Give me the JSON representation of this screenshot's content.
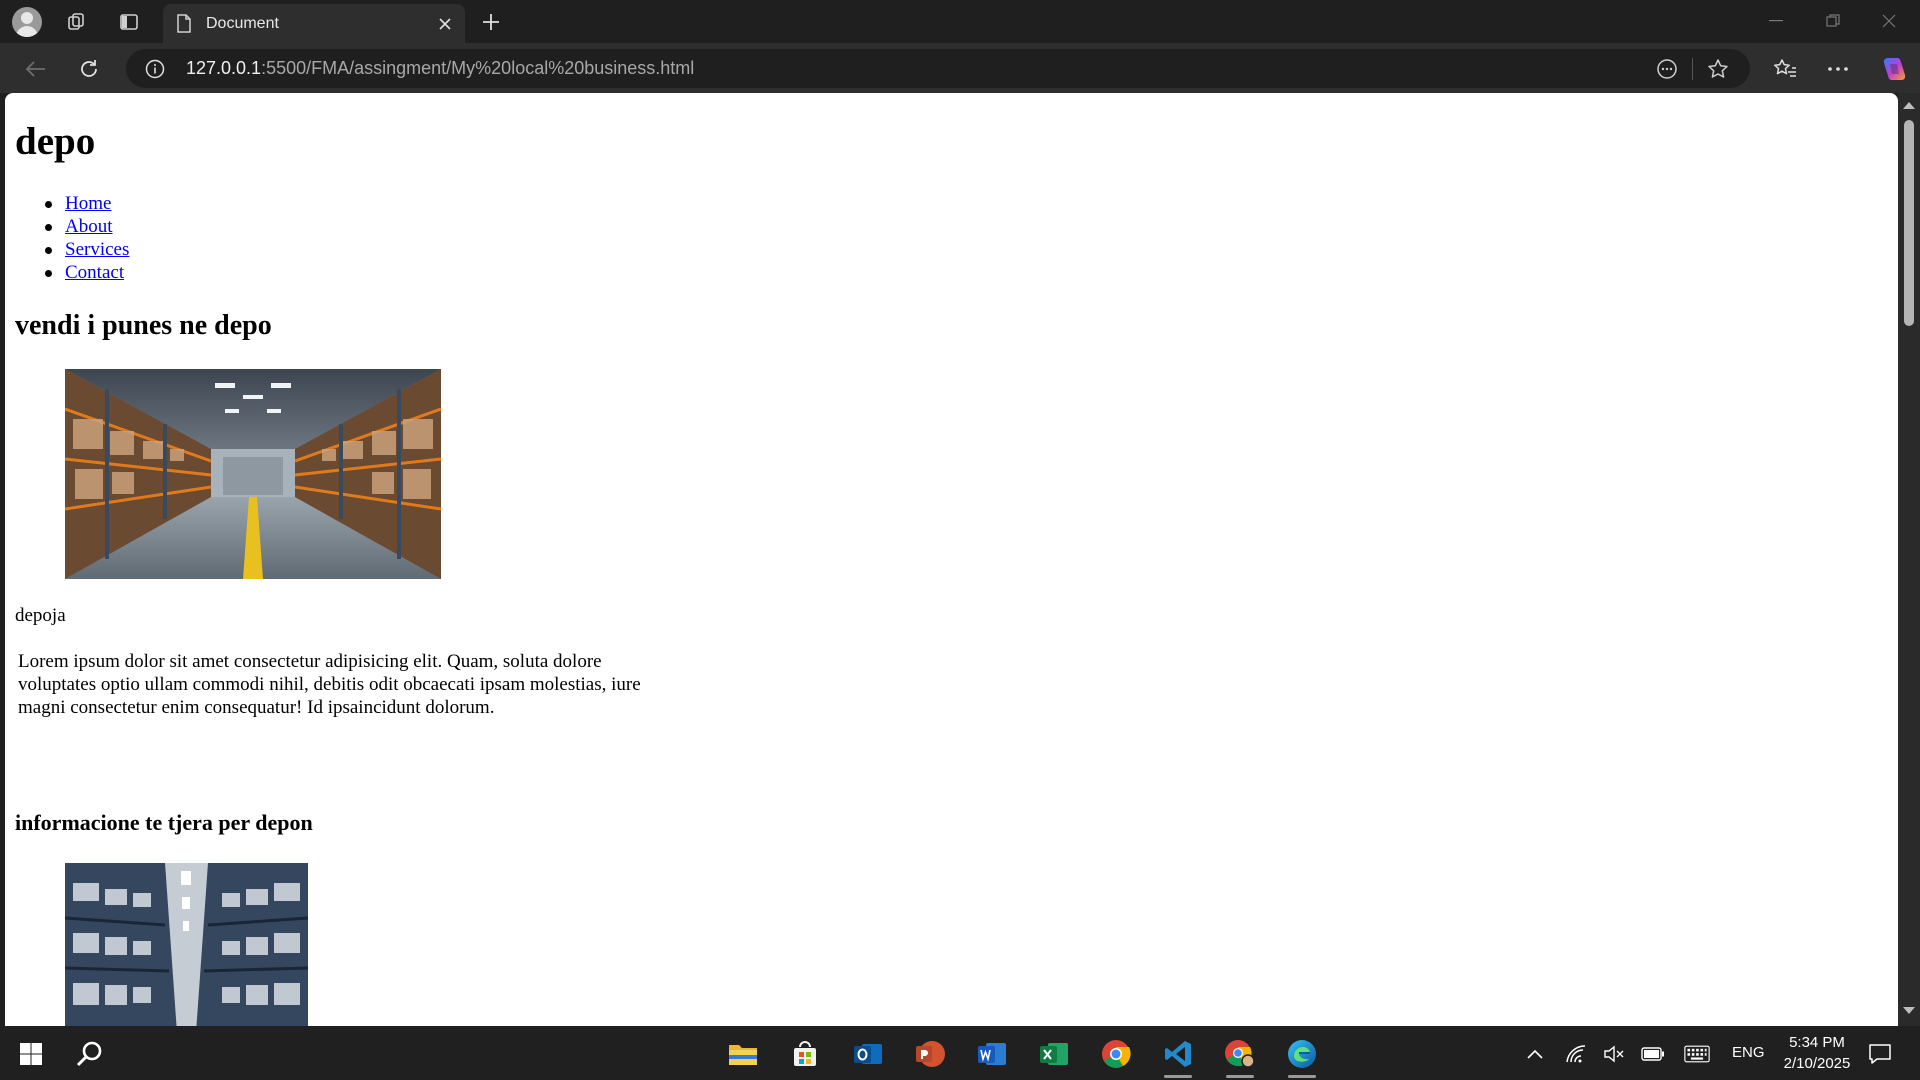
{
  "browser": {
    "tab_title": "Document",
    "url_host": "127.0.0.1",
    "url_rest": ":5500/FMA/assingment/My%20local%20business.html"
  },
  "page": {
    "heading": "depo",
    "nav": [
      "Home",
      "About",
      "Services",
      "Contact"
    ],
    "section_title": "vendi i punes ne depo",
    "caption": "depoja",
    "paragraph": "Lorem ipsum dolor sit amet consectetur adipisicing elit. Quam, soluta dolore voluptates optio ullam commodi nihil, debitis odit obcaecati ipsam molestias, iure magni consectetur enim consequatur! Id ipsaincidunt dolorum.",
    "more_info_title": "informacione te tjera per depon"
  },
  "taskbar": {
    "apps": [
      "start-icon",
      "search-icon",
      "file-explorer-icon",
      "store-icon",
      "outlook-icon",
      "powerpoint-icon",
      "word-icon",
      "excel-icon",
      "chrome-icon",
      "vscode-icon",
      "chrome-profile-icon",
      "edge-icon"
    ],
    "language": "ENG",
    "time": "5:34 PM",
    "date": "2/10/2025"
  },
  "colors": {
    "link": "#0000ee",
    "browser_frame": "#1f1f1f",
    "toolbar": "#2e2e2e"
  }
}
